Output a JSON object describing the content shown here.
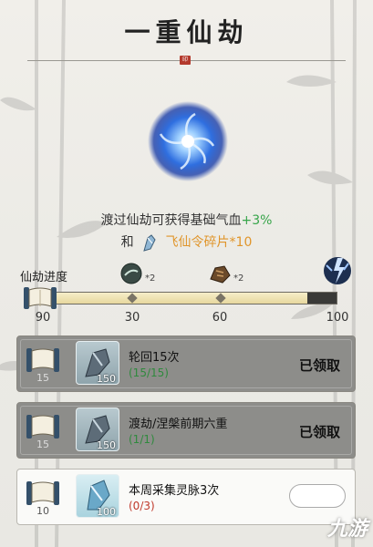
{
  "header": {
    "title": "一重仙劫"
  },
  "description": {
    "line1_text": "渡过仙劫可获得基础气血",
    "line1_bonus": "+3%",
    "line2_prefix": "和",
    "line2_reward": "飞仙令碎片*10"
  },
  "progress": {
    "label": "仙劫进度",
    "current": 90,
    "max": 100,
    "start_label": "90",
    "milestones": [
      {
        "value": "30",
        "reward_count": "*2",
        "icon": "orb-reward-icon"
      },
      {
        "value": "60",
        "reward_count": "*2",
        "icon": "pouch-reward-icon"
      },
      {
        "value": "100",
        "reward_count": "",
        "icon": "lightning-reward-icon"
      }
    ]
  },
  "tasks": [
    {
      "name": "轮回15次",
      "progress": "(15/15)",
      "scroll_count": "15",
      "item_count": "150",
      "status": "已领取",
      "state": "claimed"
    },
    {
      "name": "渡劫/涅槃前期六重",
      "progress": "(1/1)",
      "scroll_count": "15",
      "item_count": "150",
      "status": "已领取",
      "state": "claimed"
    },
    {
      "name": "本周采集灵脉3次",
      "progress": "(0/3)",
      "scroll_count": "10",
      "item_count": "100",
      "status": "",
      "state": "active"
    }
  ],
  "watermark": "九游",
  "colors": {
    "bonus": "#37a54a",
    "reward": "#e0952a",
    "progress_incomplete": "#c0392b"
  }
}
